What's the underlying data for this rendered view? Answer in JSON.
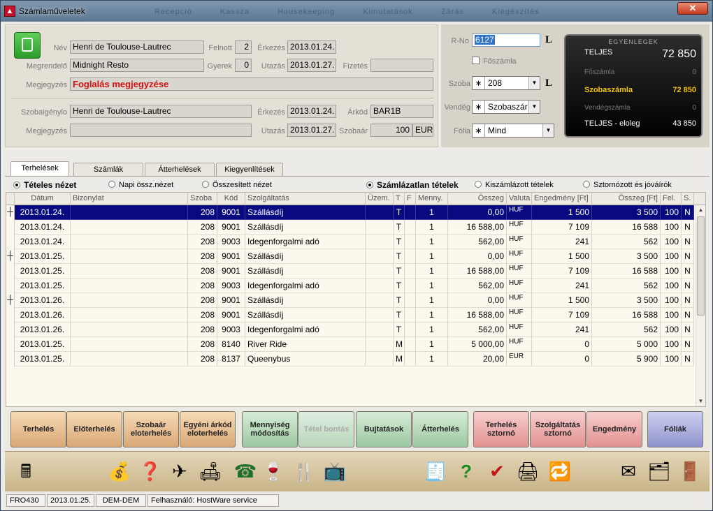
{
  "window": {
    "title": "Számlaműveletek",
    "close_glyph": "✕",
    "blur_menu": [
      "Recepció",
      "Kassza",
      "Housekeeping",
      "Kimutatások",
      "Zárás",
      "Kiegészítés"
    ]
  },
  "guest": {
    "name_label": "Név",
    "name": "Henri de Toulouse-Lautrec",
    "adult_label": "Felnott",
    "adult": "2",
    "arrival_label": "Érkezés",
    "arrival": "2013.01.24.",
    "orderer_label": "Megrendelő",
    "orderer": "Midnight Resto",
    "child_label": "Gyerek",
    "child": "0",
    "departure_label": "Utazás",
    "departure": "2013.01.27.",
    "payment_label": "Fizetés",
    "payment": "",
    "note_label": "Megjegyzés",
    "note": "Foglalás megjegyzése"
  },
  "room_req": {
    "requester_label": "Szobaigénylo",
    "requester": "Henri de Toulouse-Lautrec",
    "arrival_label": "Érkezés",
    "arrival": "2013.01.24.",
    "ratecode_label": "Árkód",
    "ratecode": "BAR1B",
    "note_label": "Megjegyzés",
    "note": "",
    "departure_label": "Utazás",
    "departure": "2013.01.27.",
    "roomrate_label": "Szobaár",
    "roomrate": "100",
    "currency": "EUR"
  },
  "right_panel": {
    "rno_label": "R-No",
    "rno": "6127",
    "l_mark": "L",
    "main_account_label": "Főszámla",
    "room_label": "Szoba",
    "room": "208",
    "guest_label": "Vendég",
    "guest": "Szobaszár",
    "folio_label": "Fólia",
    "folio": "Mind",
    "star": "∗",
    "arrow": "▼"
  },
  "balances": {
    "header": "EGYENLEGEK",
    "rows": [
      {
        "label": "TELJES",
        "value": "72 850"
      },
      {
        "label": "Főszámla",
        "value": "0"
      },
      {
        "label": "Szobaszámla",
        "value": "72 850"
      },
      {
        "label": "Vendégszámla",
        "value": "0"
      },
      {
        "label": "TELJES - eloleg",
        "value": "43 850"
      }
    ]
  },
  "tabs": [
    "Terhelések",
    "Számlák",
    "Átterhelések",
    "Kiegyenlítések"
  ],
  "view_options": [
    "Tételes nézet",
    "Napi össz.nézet",
    "Összesített nézet"
  ],
  "filter_options": [
    "Számlázatlan tételek",
    "Kiszámlázott tételek",
    "Sztornózott és jóváírók"
  ],
  "columns": [
    "Dátum",
    "Bizonylat",
    "Szoba",
    "Kód",
    "Szolgáltatás",
    "Üzem.",
    "T",
    "F",
    "Menny.",
    "Összeg",
    "Valuta",
    "Engedmény [Ft]",
    "Összeg [Ft]",
    "Fel.",
    "S."
  ],
  "rows": [
    {
      "m": "┼",
      "date": "2013.01.24.",
      "doc": "",
      "room": "208",
      "code": "9001",
      "service": "Szállásdíj",
      "unit": "",
      "t": "T",
      "f": "",
      "qty": "1",
      "amount": "0,00",
      "cur": "HUF",
      "disc": "1 500",
      "total": "3 500",
      "fel": "100",
      "s": "N"
    },
    {
      "m": "",
      "date": "2013.01.24.",
      "doc": "",
      "room": "208",
      "code": "9001",
      "service": "Szállásdíj",
      "unit": "",
      "t": "T",
      "f": "",
      "qty": "1",
      "amount": "16 588,00",
      "cur": "HUF",
      "disc": "7 109",
      "total": "16 588",
      "fel": "100",
      "s": "N"
    },
    {
      "m": "",
      "date": "2013.01.24.",
      "doc": "",
      "room": "208",
      "code": "9003",
      "service": "Idegenforgalmi adó",
      "unit": "",
      "t": "T",
      "f": "",
      "qty": "1",
      "amount": "562,00",
      "cur": "HUF",
      "disc": "241",
      "total": "562",
      "fel": "100",
      "s": "N"
    },
    {
      "m": "┼",
      "date": "2013.01.25.",
      "doc": "",
      "room": "208",
      "code": "9001",
      "service": "Szállásdíj",
      "unit": "",
      "t": "T",
      "f": "",
      "qty": "1",
      "amount": "0,00",
      "cur": "HUF",
      "disc": "1 500",
      "total": "3 500",
      "fel": "100",
      "s": "N"
    },
    {
      "m": "",
      "date": "2013.01.25.",
      "doc": "",
      "room": "208",
      "code": "9001",
      "service": "Szállásdíj",
      "unit": "",
      "t": "T",
      "f": "",
      "qty": "1",
      "amount": "16 588,00",
      "cur": "HUF",
      "disc": "7 109",
      "total": "16 588",
      "fel": "100",
      "s": "N"
    },
    {
      "m": "",
      "date": "2013.01.25.",
      "doc": "",
      "room": "208",
      "code": "9003",
      "service": "Idegenforgalmi adó",
      "unit": "",
      "t": "T",
      "f": "",
      "qty": "1",
      "amount": "562,00",
      "cur": "HUF",
      "disc": "241",
      "total": "562",
      "fel": "100",
      "s": "N"
    },
    {
      "m": "┼",
      "date": "2013.01.26.",
      "doc": "",
      "room": "208",
      "code": "9001",
      "service": "Szállásdíj",
      "unit": "",
      "t": "T",
      "f": "",
      "qty": "1",
      "amount": "0,00",
      "cur": "HUF",
      "disc": "1 500",
      "total": "3 500",
      "fel": "100",
      "s": "N"
    },
    {
      "m": "",
      "date": "2013.01.26.",
      "doc": "",
      "room": "208",
      "code": "9001",
      "service": "Szállásdíj",
      "unit": "",
      "t": "T",
      "f": "",
      "qty": "1",
      "amount": "16 588,00",
      "cur": "HUF",
      "disc": "7 109",
      "total": "16 588",
      "fel": "100",
      "s": "N"
    },
    {
      "m": "",
      "date": "2013.01.26.",
      "doc": "",
      "room": "208",
      "code": "9003",
      "service": "Idegenforgalmi adó",
      "unit": "",
      "t": "T",
      "f": "",
      "qty": "1",
      "amount": "562,00",
      "cur": "HUF",
      "disc": "241",
      "total": "562",
      "fel": "100",
      "s": "N"
    },
    {
      "m": "",
      "date": "2013.01.25.",
      "doc": "",
      "room": "208",
      "code": "8140",
      "service": "River Ride",
      "unit": "",
      "t": "M",
      "f": "",
      "qty": "1",
      "amount": "5 000,00",
      "cur": "HUF",
      "disc": "0",
      "total": "5 000",
      "fel": "100",
      "s": "N"
    },
    {
      "m": "",
      "date": "2013.01.25.",
      "doc": "",
      "room": "208",
      "code": "8137",
      "service": "Queenybus",
      "unit": "",
      "t": "M",
      "f": "",
      "qty": "1",
      "amount": "20,00",
      "cur": "EUR",
      "disc": "0",
      "total": "5 900",
      "fel": "100",
      "s": "N"
    }
  ],
  "actions": [
    "Terhelés",
    "Előterhelés",
    "Szobaár eloterhelés",
    "Egyéni árkód eloterhelés",
    "Mennyiség módosítás",
    "Tétel bontás",
    "Bujtatások",
    "Átterhelés",
    "Terhelés sztornó",
    "Szolgáltatás sztornó",
    "Engedmény",
    "Fóliák"
  ],
  "icons": [
    "🖩",
    "💰",
    "❓",
    "✈",
    "🛋",
    "☎",
    "🍷",
    "🍴",
    "📺",
    "🧾",
    "?",
    "✔",
    "🖨",
    "🔁",
    "✉",
    "🗂",
    "🚪"
  ],
  "status": {
    "code": "FRO430",
    "date": "2013.01.25.",
    "db": "DEM-DEM",
    "user": "Felhasználó: HostWare service"
  }
}
